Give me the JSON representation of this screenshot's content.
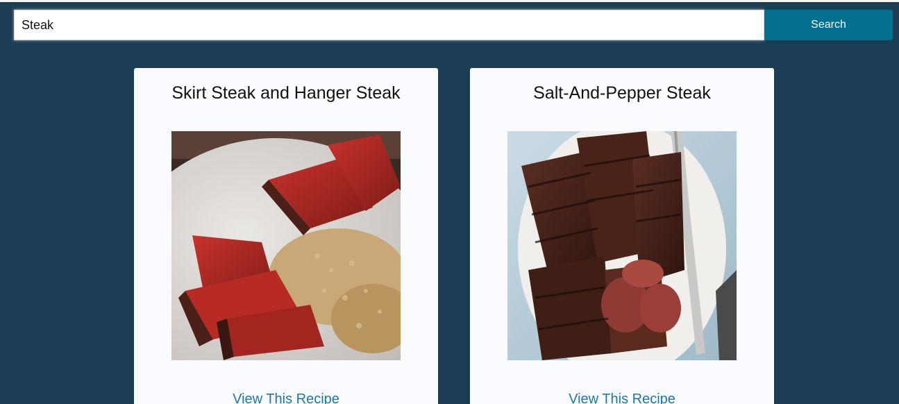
{
  "search": {
    "value": "Steak",
    "button_label": "Search"
  },
  "recipes": [
    {
      "title": "Skirt Steak and Hanger Steak",
      "link_label": "View This Recipe",
      "image": "sliced-steak-with-risotto-photo"
    },
    {
      "title": "Salt-And-Pepper Steak",
      "link_label": "View This Recipe",
      "image": "grilled-skirt-steak-platter-photo"
    }
  ],
  "colors": {
    "background": "#1c3e54",
    "button": "#04708f",
    "card": "#fafbff",
    "link": "#1a78a8"
  }
}
